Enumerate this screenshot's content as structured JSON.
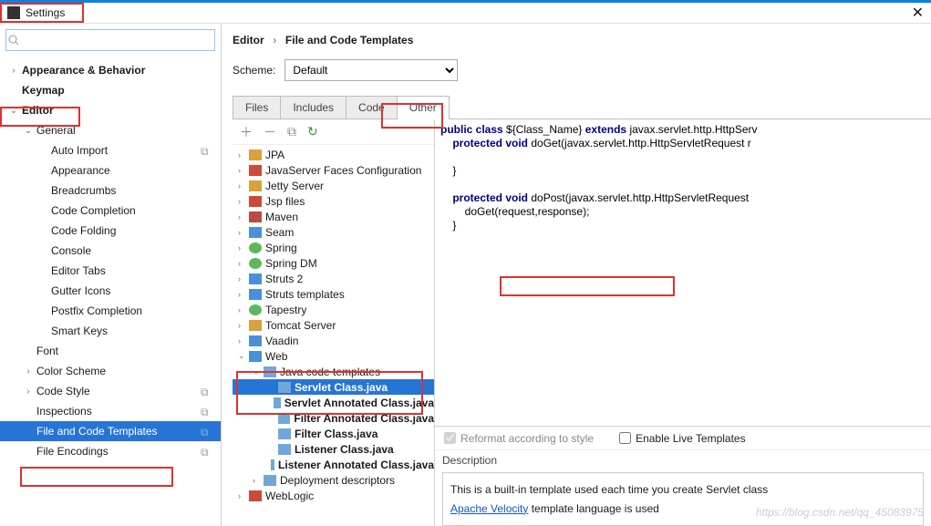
{
  "window": {
    "title": "Settings"
  },
  "breadcrumb": {
    "a": "Editor",
    "b": "File and Code Templates"
  },
  "scheme": {
    "label": "Scheme:",
    "value": "Default"
  },
  "tabs": [
    "Files",
    "Includes",
    "Code",
    "Other"
  ],
  "sidebar": {
    "items": [
      {
        "label": "Appearance & Behavior",
        "bold": true,
        "arrow": "›",
        "lvl": 0
      },
      {
        "label": "Keymap",
        "bold": true,
        "arrow": "",
        "lvl": 0
      },
      {
        "label": "Editor",
        "bold": true,
        "arrow": "⌄",
        "lvl": 0
      },
      {
        "label": "General",
        "bold": false,
        "arrow": "⌄",
        "lvl": 1
      },
      {
        "label": "Auto Import",
        "arrow": "",
        "lvl": 2,
        "copy": true
      },
      {
        "label": "Appearance",
        "arrow": "",
        "lvl": 2
      },
      {
        "label": "Breadcrumbs",
        "arrow": "",
        "lvl": 2
      },
      {
        "label": "Code Completion",
        "arrow": "",
        "lvl": 2
      },
      {
        "label": "Code Folding",
        "arrow": "",
        "lvl": 2
      },
      {
        "label": "Console",
        "arrow": "",
        "lvl": 2
      },
      {
        "label": "Editor Tabs",
        "arrow": "",
        "lvl": 2
      },
      {
        "label": "Gutter Icons",
        "arrow": "",
        "lvl": 2
      },
      {
        "label": "Postfix Completion",
        "arrow": "",
        "lvl": 2
      },
      {
        "label": "Smart Keys",
        "arrow": "",
        "lvl": 2
      },
      {
        "label": "Font",
        "arrow": "",
        "lvl": 1
      },
      {
        "label": "Color Scheme",
        "arrow": "›",
        "lvl": 1
      },
      {
        "label": "Code Style",
        "arrow": "›",
        "lvl": 1,
        "copy": true
      },
      {
        "label": "Inspections",
        "arrow": "",
        "lvl": 1,
        "copy": true
      },
      {
        "label": "File and Code Templates",
        "arrow": "",
        "lvl": 1,
        "copy": true,
        "selected": true
      },
      {
        "label": "File Encodings",
        "arrow": "",
        "lvl": 1,
        "copy": true
      }
    ]
  },
  "tpl": {
    "toolbar": [
      "＋",
      "－",
      "⧉",
      "↻"
    ],
    "items": [
      {
        "label": "JPA",
        "arrow": "›",
        "lvl": 0,
        "ic": "ic-folder"
      },
      {
        "label": "JavaServer Faces Configuration",
        "arrow": "›",
        "lvl": 0,
        "ic": "ic-red"
      },
      {
        "label": "Jetty Server",
        "arrow": "›",
        "lvl": 0,
        "ic": "ic-folder"
      },
      {
        "label": "Jsp files",
        "arrow": "›",
        "lvl": 0,
        "ic": "ic-red"
      },
      {
        "label": "Maven",
        "arrow": "›",
        "lvl": 0,
        "ic": "ic-m"
      },
      {
        "label": "Seam",
        "arrow": "›",
        "lvl": 0,
        "ic": "ic-blue"
      },
      {
        "label": "Spring",
        "arrow": "›",
        "lvl": 0,
        "ic": "ic-green"
      },
      {
        "label": "Spring DM",
        "arrow": "›",
        "lvl": 0,
        "ic": "ic-green"
      },
      {
        "label": "Struts 2",
        "arrow": "›",
        "lvl": 0,
        "ic": "ic-blue"
      },
      {
        "label": "Struts templates",
        "arrow": "›",
        "lvl": 0,
        "ic": "ic-blue"
      },
      {
        "label": "Tapestry",
        "arrow": "›",
        "lvl": 0,
        "ic": "ic-green"
      },
      {
        "label": "Tomcat Server",
        "arrow": "›",
        "lvl": 0,
        "ic": "ic-folder"
      },
      {
        "label": "Vaadin",
        "arrow": "›",
        "lvl": 0,
        "ic": "ic-blue"
      },
      {
        "label": "Web",
        "arrow": "⌄",
        "lvl": 0,
        "ic": "ic-blue"
      },
      {
        "label": "Java code templates",
        "arrow": "⌄",
        "lvl": 1,
        "ic": "ic-file"
      },
      {
        "label": "Servlet Class.java",
        "arrow": "",
        "lvl": 2,
        "ic": "ic-file",
        "sel": true,
        "bold": true
      },
      {
        "label": "Servlet Annotated Class.java",
        "arrow": "",
        "lvl": 2,
        "ic": "ic-file",
        "bold": true
      },
      {
        "label": "Filter Annotated Class.java",
        "arrow": "",
        "lvl": 2,
        "ic": "ic-file",
        "bold": true
      },
      {
        "label": "Filter Class.java",
        "arrow": "",
        "lvl": 2,
        "ic": "ic-file",
        "bold": true
      },
      {
        "label": "Listener Class.java",
        "arrow": "",
        "lvl": 2,
        "ic": "ic-file",
        "bold": true
      },
      {
        "label": "Listener Annotated Class.java",
        "arrow": "",
        "lvl": 2,
        "ic": "ic-file",
        "bold": true
      },
      {
        "label": "Deployment descriptors",
        "arrow": "›",
        "lvl": 1,
        "ic": "ic-file"
      },
      {
        "label": "WebLogic",
        "arrow": "›",
        "lvl": 0,
        "ic": "ic-red"
      }
    ]
  },
  "code": {
    "l1a": "public class ",
    "l1b": "${Class_Name}",
    "l1c": " extends ",
    "l1d": "javax.servlet.http.HttpServ",
    "l2a": "    protected void ",
    "l2b": "doGet(javax.servlet.http.HttpServletRequest r",
    "l3": "",
    "l4": "    }",
    "l5": "",
    "l6a": "    protected void ",
    "l6b": "doPost(javax.servlet.http.HttpServletRequest",
    "l7": "        doGet(request,response);",
    "l8": "    }"
  },
  "options": {
    "reformat": "Reformat according to style",
    "live": "Enable Live Templates"
  },
  "desc": {
    "header": "Description",
    "line1": "This is a built-in template used each time you create Servlet class",
    "link": "Apache Velocity",
    "line2": " template language is used"
  },
  "watermark": "https://blog.csdn.net/qq_45083975"
}
